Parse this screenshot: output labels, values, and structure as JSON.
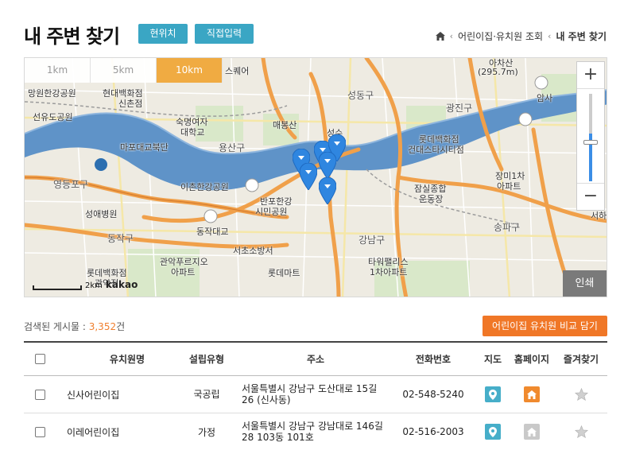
{
  "header": {
    "title": "내 주변 찾기",
    "btn_current": "현위치",
    "btn_direct": "직접입력",
    "breadcrumb": [
      "어린이집·유치원 조회",
      "내 주변 찾기"
    ]
  },
  "map": {
    "radius_tabs": [
      {
        "label": "1km",
        "active": false
      },
      {
        "label": "5km",
        "active": false
      },
      {
        "label": "10km",
        "active": true
      }
    ],
    "labels": [
      "망원한강공원",
      "현대백화점",
      "신촌점",
      "선유도공원",
      "숙명여자",
      "대학교",
      "마포대교북단",
      "용산구",
      "매봉산",
      "성동구",
      "성수",
      "광진구",
      "롯데백화점",
      "건대스타시티점",
      "영등포구",
      "이촌한강공원",
      "반포한강",
      "시민공원",
      "잠실종합",
      "운동장",
      "장미1차",
      "아파트",
      "성애병원",
      "동작대교",
      "동작구",
      "서초소방서",
      "강남구",
      "송파구",
      "관악푸르지오",
      "아파트",
      "롯데백화점",
      "관악점",
      "롯데마트",
      "타워팰리스",
      "1차아파트",
      "아차산",
      "(295.7m)",
      "암사",
      "서하",
      "스퀘어"
    ],
    "zoom_in": "+",
    "zoom_out": "−",
    "scale": "2km",
    "brand": "kakao",
    "print": "인쇄"
  },
  "results": {
    "label": "검색된 게시물 : ",
    "count": "3,352",
    "unit": "건",
    "compare_button": "어린이집 유치원 비교 담기"
  },
  "table": {
    "headers": {
      "name": "유치원명",
      "type": "설립유형",
      "address": "주소",
      "phone": "전화번호",
      "map": "지도",
      "homepage": "홈페이지",
      "favorite": "즐겨찾기"
    },
    "rows": [
      {
        "name": "신사어린이집",
        "type": "국공립",
        "address": "서울특별시 강남구 도산대로 15길 26 (신사동)",
        "phone": "02-548-5240"
      },
      {
        "name": "이레어린이집",
        "type": "가정",
        "address": "서울특별시 강남구 강남대로 146길 28 103동 101호",
        "phone": "02-516-2003"
      }
    ]
  },
  "colors": {
    "accent_blue": "#3aa6c4",
    "accent_orange": "#f07727",
    "tab_active": "#f0ab42",
    "river": "#5f93c8",
    "pin": "#2f86e0"
  }
}
